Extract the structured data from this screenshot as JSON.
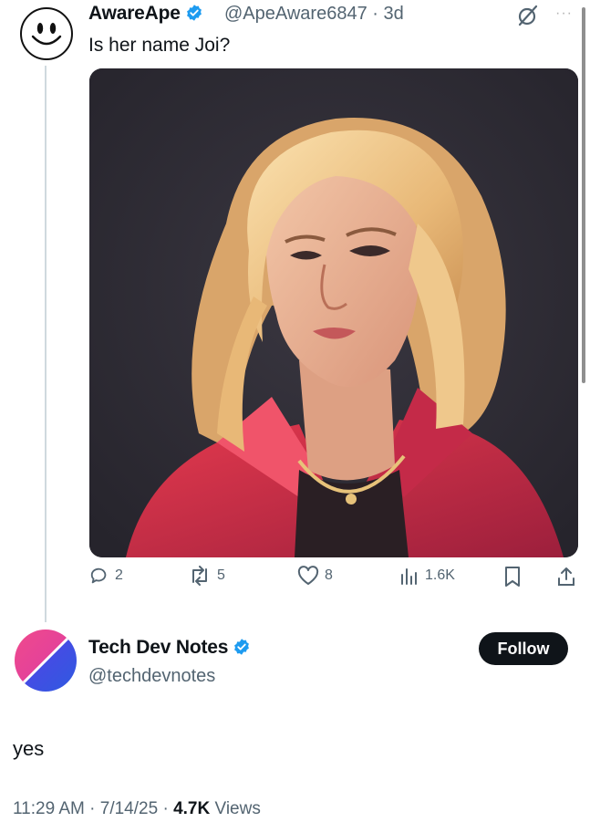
{
  "parent_tweet": {
    "display_name": "AwareApe",
    "handle": "@ApeAware6847",
    "separator": " · ",
    "age": "3d",
    "text": "Is her name Joi?",
    "more_label": "···",
    "actions": {
      "replies": "2",
      "reposts": "5",
      "likes": "8",
      "views": "1.6K"
    }
  },
  "main_tweet": {
    "display_name": "Tech Dev Notes",
    "handle": "@techdevnotes",
    "follow_label": "Follow",
    "text": "yes",
    "time": "11:29 AM",
    "date": "7/14/25",
    "views_count": "4.7K",
    "views_label": "Views",
    "separator": " · "
  },
  "colors": {
    "verified_blue": "#1d9bf0",
    "text_primary": "#0f1419",
    "text_secondary": "#536471",
    "media_background": "#2c2a33",
    "avatar_gradient_pink": "#e0409a",
    "avatar_gradient_blue": "#3a4de0"
  },
  "icons": {
    "parent_avatar": "smiley-face-icon",
    "verified": "verified-badge-icon",
    "grok": "grok-slash-icon",
    "reply": "reply-bubble-icon",
    "repost": "repost-arrows-icon",
    "like": "heart-icon",
    "views": "bar-chart-icon",
    "bookmark": "bookmark-icon",
    "share": "share-upload-icon"
  }
}
